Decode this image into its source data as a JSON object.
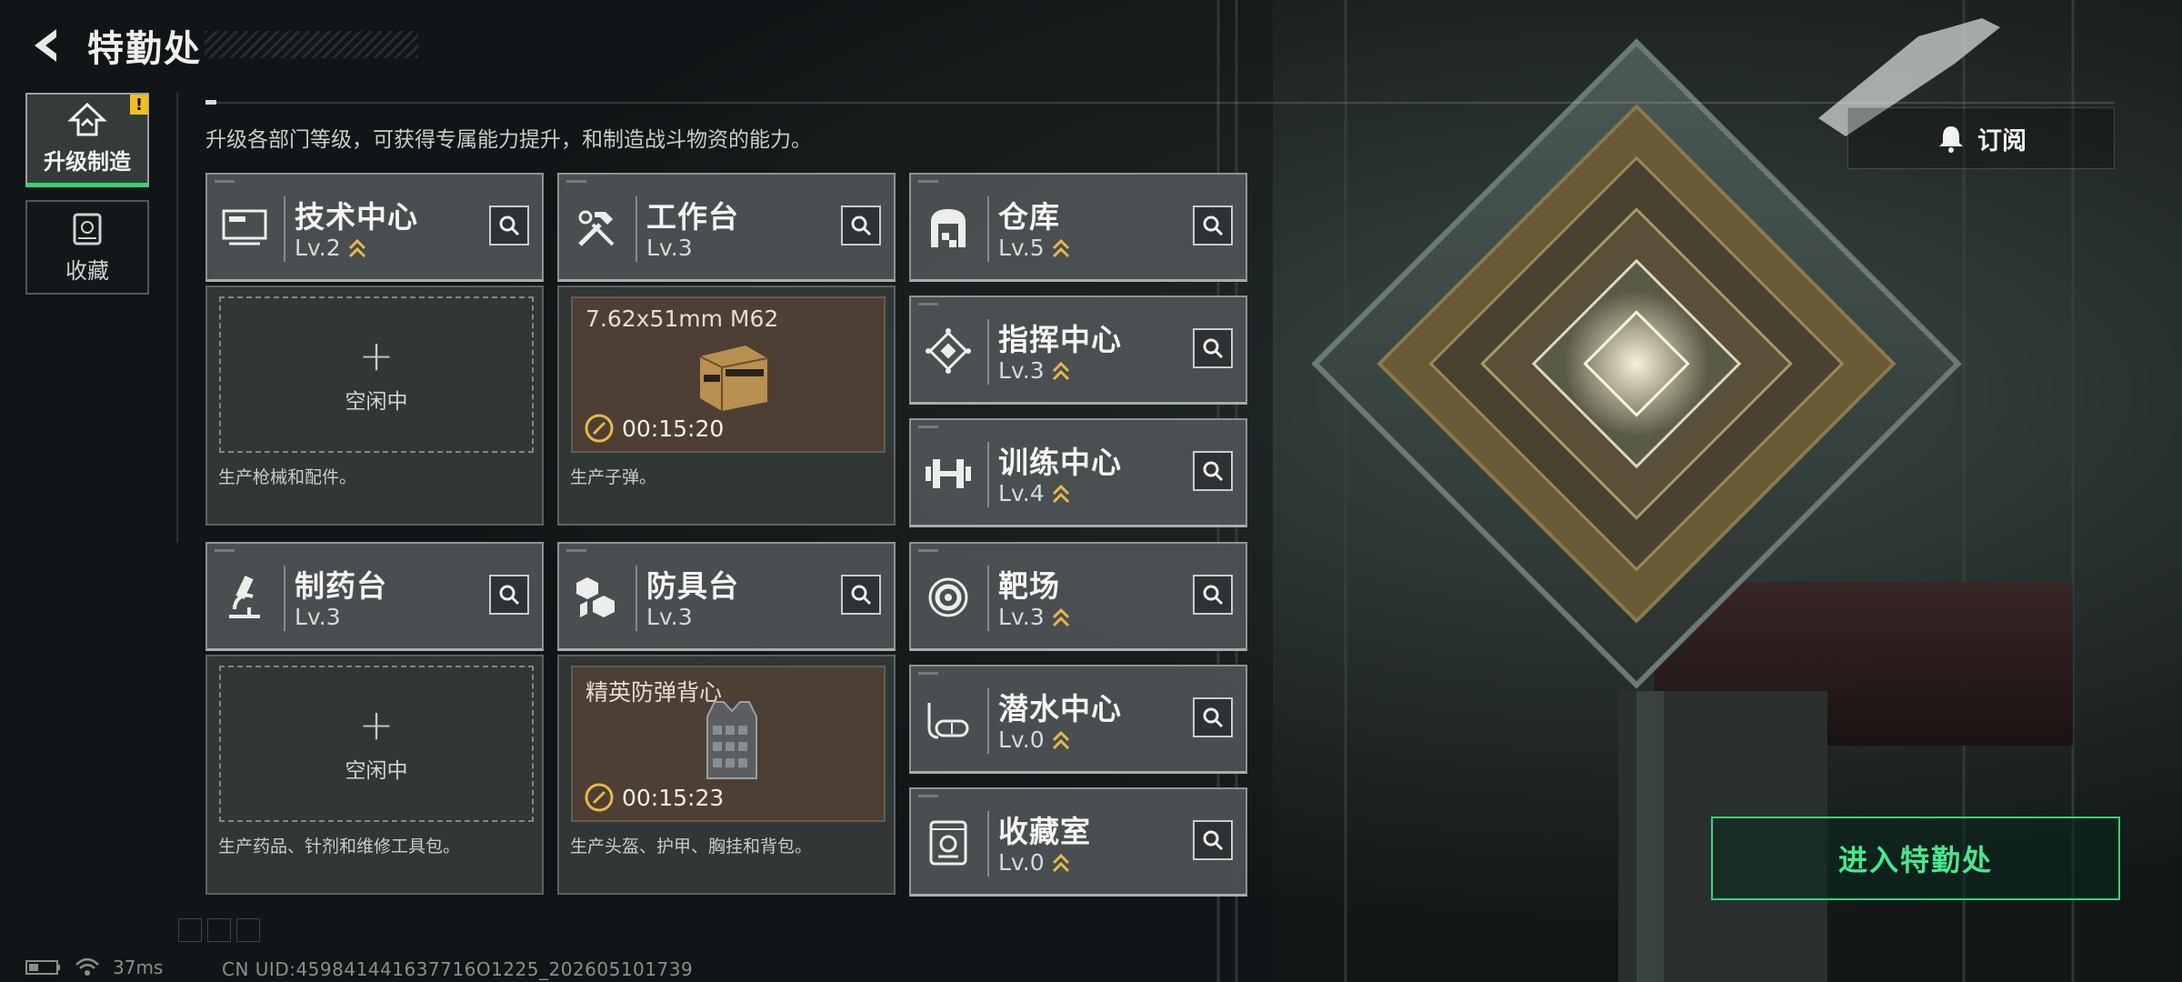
{
  "header": {
    "title": "特勤处"
  },
  "side_nav": [
    {
      "label": "升级制造",
      "active": true,
      "icon": "upgrade-icon",
      "alert": "!"
    },
    {
      "label": "收藏",
      "active": false,
      "icon": "collection-icon"
    }
  ],
  "subtitle": "升级各部门等级，可获得专属能力提升，和制造战斗物资的能力。",
  "subscribe": {
    "label": "订阅",
    "icon": "bell-icon"
  },
  "facilities": {
    "tech_center": {
      "name": "技术中心",
      "level": "Lv.2",
      "icon": "monitor-icon",
      "slot": {
        "state": "idle",
        "label": "空闲中"
      },
      "desc": "生产枪械和配件。"
    },
    "workbench": {
      "name": "工作台",
      "level": "Lv.3",
      "icon": "tools-icon",
      "slot": {
        "state": "producing",
        "item": "7.62x51mm M62",
        "timer": "00:15:20",
        "item_icon": "ammo-box-icon"
      },
      "desc": "生产子弹。"
    },
    "pharmacy": {
      "name": "制药台",
      "level": "Lv.3",
      "icon": "microscope-icon",
      "slot": {
        "state": "idle",
        "label": "空闲中"
      },
      "desc": "生产药品、针剂和维修工具包。"
    },
    "armor_bench": {
      "name": "防具台",
      "level": "Lv.3",
      "icon": "cubes-icon",
      "slot": {
        "state": "producing",
        "item": "精英防弹背心",
        "timer": "00:15:23",
        "item_icon": "vest-icon"
      },
      "desc": "生产头盔、护甲、胸挂和背包。"
    },
    "warehouse": {
      "name": "仓库",
      "level": "Lv.5",
      "icon": "warehouse-icon"
    },
    "command": {
      "name": "指挥中心",
      "level": "Lv.3",
      "icon": "command-icon"
    },
    "training": {
      "name": "训练中心",
      "level": "Lv.4",
      "icon": "dumbbell-icon"
    },
    "range": {
      "name": "靶场",
      "level": "Lv.3",
      "icon": "target-icon"
    },
    "diving": {
      "name": "潜水中心",
      "level": "Lv.0",
      "icon": "diving-mask-icon"
    },
    "collection_room": {
      "name": "收藏室",
      "level": "Lv.0",
      "icon": "trophy-case-icon"
    }
  },
  "enter_button": {
    "label": "进入特勤处"
  },
  "status": {
    "ping": "37ms",
    "uid": "CN UID:459841441637716O1225_202605101739"
  },
  "colors": {
    "accent_green": "#2fd675",
    "level_chevron": "#e8b84a",
    "production_bg": "#4d3f33"
  }
}
